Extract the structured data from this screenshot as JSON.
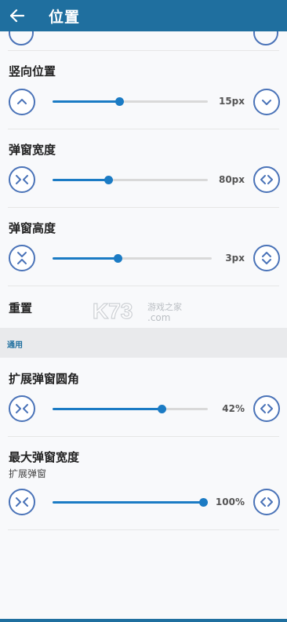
{
  "appbar": {
    "title": "位置",
    "back_icon": "arrow-left-icon"
  },
  "rows": [
    {
      "label": "竖向位置",
      "value": "15px",
      "percent": 43,
      "left_icon": "chevron-up-icon",
      "right_icon": "chevron-down-icon"
    },
    {
      "label": "弹窗宽度",
      "value": "80px",
      "percent": 36,
      "left_icon": "chevrons-inward-icon",
      "right_icon": "chevrons-outward-icon"
    },
    {
      "label": "弹窗高度",
      "value": "3px",
      "percent": 41,
      "left_icon": "chevrons-vertical-inward-icon",
      "right_icon": "chevrons-vertical-outward-icon"
    }
  ],
  "reset_label": "重置",
  "section_header": "通用",
  "rows2": [
    {
      "label": "扩展弹窗圆角",
      "value": "42%",
      "percent": 70,
      "left_icon": "chevrons-inward-icon",
      "right_icon": "chevrons-outward-icon"
    },
    {
      "label": "最大弹窗宽度",
      "sublabel": "扩展弹窗",
      "value": "100%",
      "percent": 100,
      "left_icon": "chevrons-inward-icon",
      "right_icon": "chevrons-outward-icon"
    }
  ],
  "watermark": {
    "brand": "K73",
    "text": "游戏之家",
    "domain": ".com"
  },
  "colors": {
    "accent": "#1f6f9f",
    "slider": "#1b7bc4",
    "button_border": "#4a73b8"
  }
}
